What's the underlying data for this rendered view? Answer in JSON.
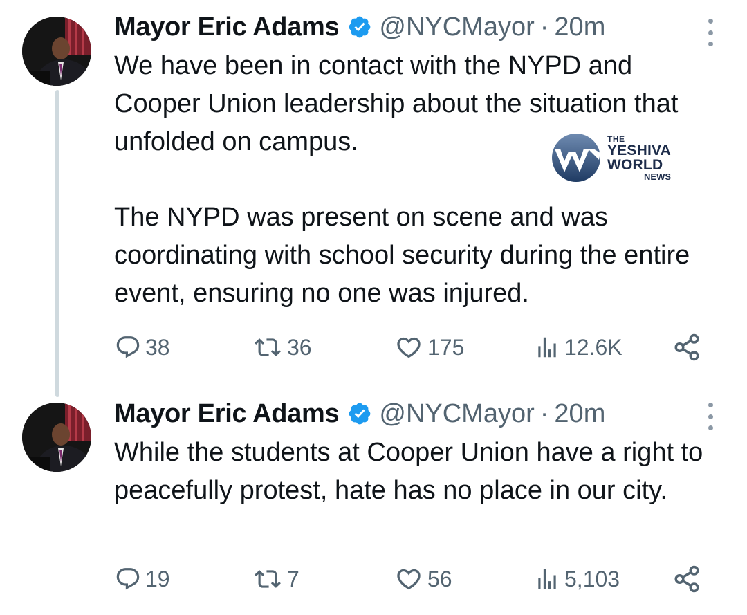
{
  "tweets": [
    {
      "author_name": "Mayor Eric Adams",
      "handle": "@NYCMayor",
      "separator": "·",
      "time": "20m",
      "paragraphs": [
        "We have been in contact with the NYPD and Cooper Union leadership about the situation that unfolded on campus.",
        "The NYPD was present on scene and was coordinating with school security during the entire event, ensuring no one was injured."
      ],
      "stats": {
        "replies": "38",
        "reposts": "36",
        "likes": "175",
        "views": "12.6K"
      }
    },
    {
      "author_name": "Mayor Eric Adams",
      "handle": "@NYCMayor",
      "separator": "·",
      "time": "20m",
      "paragraphs": [
        "While the students at Cooper Union have a right to peacefully protest, hate has no place in our city."
      ],
      "stats": {
        "replies": "19",
        "reposts": "7",
        "likes": "56",
        "views": "5,103"
      }
    }
  ],
  "watermark": {
    "line1": "THE",
    "line2": "YESHIVA",
    "line3": "WORLD",
    "line4": "NEWS"
  },
  "icons": {
    "verified": "verified-badge-icon",
    "more": "more-vertical-icon",
    "reply": "reply-bubble-icon",
    "repost": "repost-arrows-icon",
    "like": "heart-icon",
    "views": "views-bars-icon",
    "share": "share-icon"
  },
  "colors": {
    "text": "#0f1419",
    "secondary": "#536471",
    "verified": "#1d9bf0",
    "thread_line": "#cfd9de",
    "watermark": "#1d2c4a"
  }
}
